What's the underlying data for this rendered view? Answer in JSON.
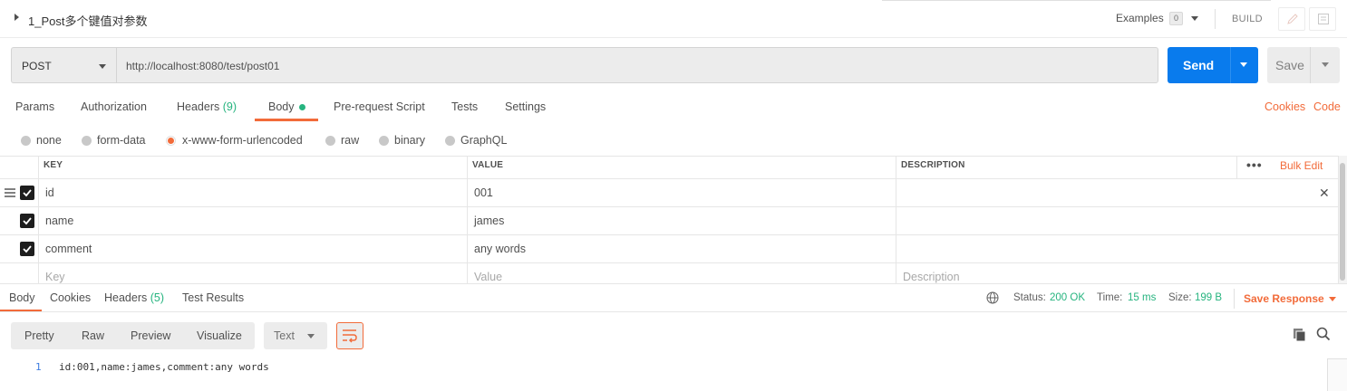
{
  "header": {
    "request_name": "1_Post多个键值对参数",
    "examples_label": "Examples",
    "examples_count": "0",
    "build_label": "BUILD",
    "edit_icon": "pencil-icon",
    "docs_icon": "documentation-icon"
  },
  "request": {
    "method": "POST",
    "url": "http://localhost:8080/test/post01",
    "send_label": "Send",
    "save_label": "Save"
  },
  "request_tabs": {
    "params": "Params",
    "authorization": "Authorization",
    "headers": "Headers",
    "headers_count": "(9)",
    "body": "Body",
    "pre_request": "Pre-request Script",
    "tests": "Tests",
    "settings": "Settings",
    "cookies": "Cookies",
    "code": "Code"
  },
  "body_modes": {
    "none": "none",
    "form_data": "form-data",
    "urlencoded": "x-www-form-urlencoded",
    "raw": "raw",
    "binary": "binary",
    "graphql": "GraphQL",
    "selected": "x-www-form-urlencoded"
  },
  "params_table": {
    "headers": {
      "key": "KEY",
      "value": "VALUE",
      "description": "DESCRIPTION",
      "more": "•••",
      "bulk_edit": "Bulk Edit"
    },
    "rows": [
      {
        "checked": true,
        "key": "id",
        "value": "001",
        "description": ""
      },
      {
        "checked": true,
        "key": "name",
        "value": "james",
        "description": ""
      },
      {
        "checked": true,
        "key": "comment",
        "value": "any words",
        "description": ""
      }
    ],
    "placeholders": {
      "key": "Key",
      "value": "Value",
      "description": "Description"
    }
  },
  "response": {
    "tabs": {
      "body": "Body",
      "cookies": "Cookies",
      "headers": "Headers",
      "headers_count": "(5)",
      "test_results": "Test Results"
    },
    "status_label": "Status:",
    "status_value": "200 OK",
    "time_label": "Time:",
    "time_value": "15 ms",
    "size_label": "Size:",
    "size_value": "199 B",
    "save_response": "Save Response",
    "formats": {
      "pretty": "Pretty",
      "raw": "Raw",
      "preview": "Preview",
      "visualize": "Visualize"
    },
    "text_type": "Text",
    "line_number": "1",
    "body_text": "id:001,name:james,comment:any words"
  },
  "colors": {
    "accent": "#f26b3a",
    "send_blue": "#097bed",
    "success_green": "#26b47f"
  }
}
